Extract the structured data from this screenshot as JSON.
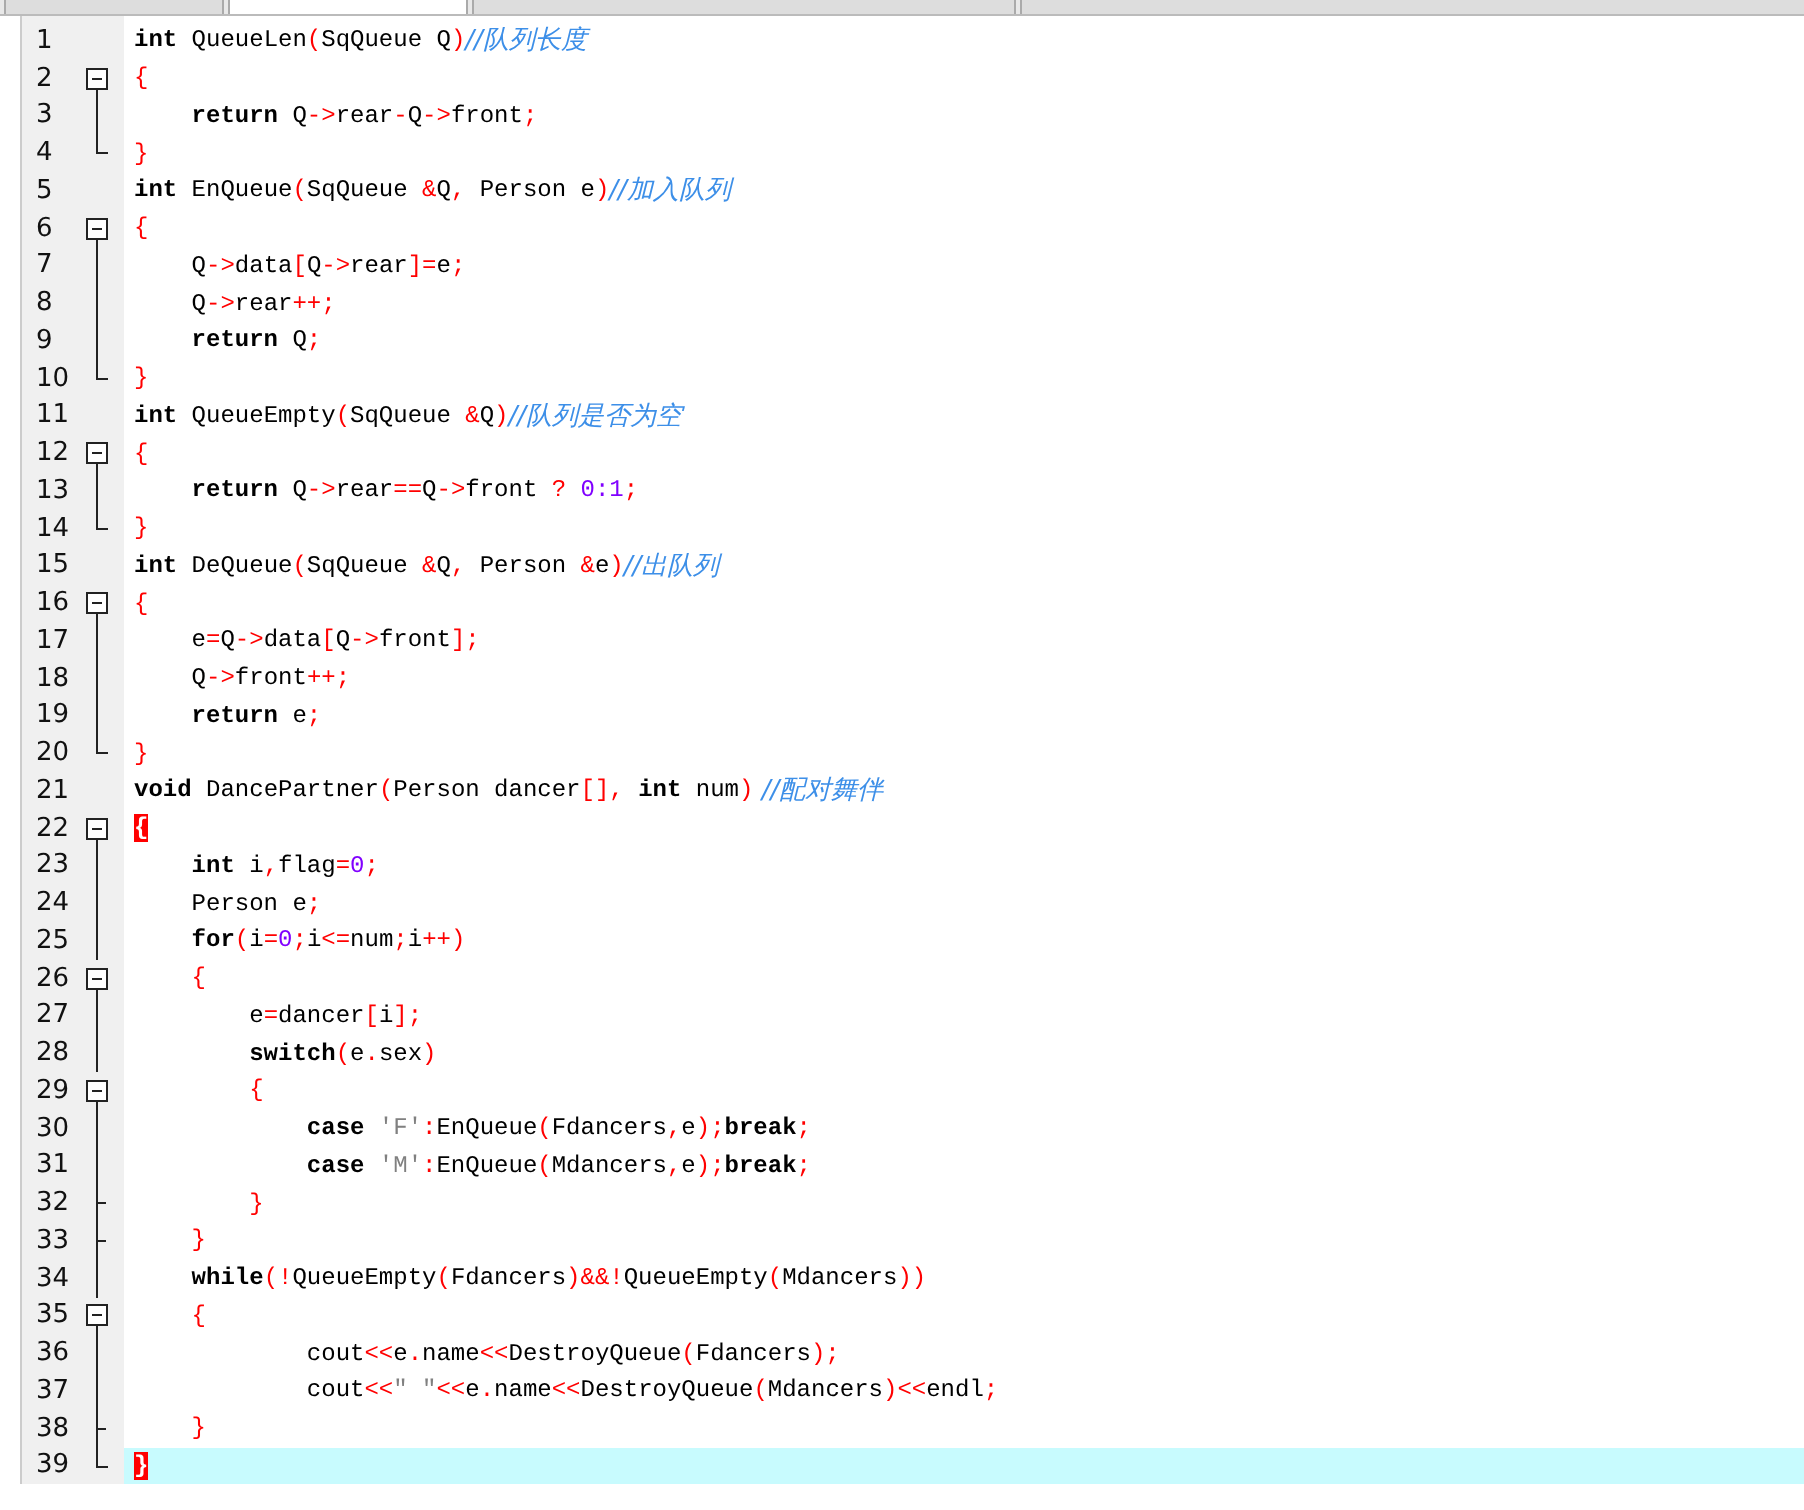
{
  "tabs": [
    {
      "selected": false
    },
    {
      "selected": true
    },
    {
      "selected": false
    },
    {
      "selected": false
    }
  ],
  "editor": {
    "lines": [
      {
        "number": "1",
        "kind": "fold-none",
        "current": false,
        "tokens": [
          {
            "kind": "kw",
            "text": "int"
          },
          {
            "kind": "id",
            "text": " QueueLen"
          },
          {
            "kind": "op",
            "text": "("
          },
          {
            "kind": "id",
            "text": "SqQueue Q"
          },
          {
            "kind": "op",
            "text": ")"
          },
          {
            "kind": "cmt",
            "text": "//队列长度"
          }
        ]
      },
      {
        "number": "2",
        "kind": "fold-open",
        "current": false,
        "tokens": [
          {
            "kind": "op",
            "text": "{"
          }
        ]
      },
      {
        "number": "3",
        "kind": "fold-body",
        "current": false,
        "tokens": [
          {
            "kind": "kw",
            "text": "    return"
          },
          {
            "kind": "id",
            "text": " Q"
          },
          {
            "kind": "op",
            "text": "->"
          },
          {
            "kind": "id",
            "text": "rear"
          },
          {
            "kind": "op",
            "text": "-"
          },
          {
            "kind": "id",
            "text": "Q"
          },
          {
            "kind": "op",
            "text": "->"
          },
          {
            "kind": "id",
            "text": "front"
          },
          {
            "kind": "op",
            "text": ";"
          }
        ]
      },
      {
        "number": "4",
        "kind": "fold-end",
        "current": false,
        "tokens": [
          {
            "kind": "op",
            "text": "}"
          }
        ]
      },
      {
        "number": "5",
        "kind": "fold-none",
        "current": false,
        "tokens": [
          {
            "kind": "kw",
            "text": "int"
          },
          {
            "kind": "id",
            "text": " EnQueue"
          },
          {
            "kind": "op",
            "text": "("
          },
          {
            "kind": "id",
            "text": "SqQueue "
          },
          {
            "kind": "op",
            "text": "&"
          },
          {
            "kind": "id",
            "text": "Q"
          },
          {
            "kind": "op",
            "text": ","
          },
          {
            "kind": "id",
            "text": " Person e"
          },
          {
            "kind": "op",
            "text": ")"
          },
          {
            "kind": "cmt",
            "text": "//加入队列"
          }
        ]
      },
      {
        "number": "6",
        "kind": "fold-open",
        "current": false,
        "tokens": [
          {
            "kind": "op",
            "text": "{"
          }
        ]
      },
      {
        "number": "7",
        "kind": "fold-body",
        "current": false,
        "tokens": [
          {
            "kind": "id",
            "text": "    Q"
          },
          {
            "kind": "op",
            "text": "->"
          },
          {
            "kind": "id",
            "text": "data"
          },
          {
            "kind": "op",
            "text": "["
          },
          {
            "kind": "id",
            "text": "Q"
          },
          {
            "kind": "op",
            "text": "->"
          },
          {
            "kind": "id",
            "text": "rear"
          },
          {
            "kind": "op",
            "text": "]="
          },
          {
            "kind": "id",
            "text": "e"
          },
          {
            "kind": "op",
            "text": ";"
          }
        ]
      },
      {
        "number": "8",
        "kind": "fold-body",
        "current": false,
        "tokens": [
          {
            "kind": "id",
            "text": "    Q"
          },
          {
            "kind": "op",
            "text": "->"
          },
          {
            "kind": "id",
            "text": "rear"
          },
          {
            "kind": "op",
            "text": "++;"
          }
        ]
      },
      {
        "number": "9",
        "kind": "fold-body",
        "current": false,
        "tokens": [
          {
            "kind": "kw",
            "text": "    return"
          },
          {
            "kind": "id",
            "text": " Q"
          },
          {
            "kind": "op",
            "text": ";"
          }
        ]
      },
      {
        "number": "10",
        "kind": "fold-end",
        "current": false,
        "tokens": [
          {
            "kind": "op",
            "text": "}"
          }
        ]
      },
      {
        "number": "11",
        "kind": "fold-none",
        "current": false,
        "tokens": [
          {
            "kind": "kw",
            "text": "int"
          },
          {
            "kind": "id",
            "text": " QueueEmpty"
          },
          {
            "kind": "op",
            "text": "("
          },
          {
            "kind": "id",
            "text": "SqQueue "
          },
          {
            "kind": "op",
            "text": "&"
          },
          {
            "kind": "id",
            "text": "Q"
          },
          {
            "kind": "op",
            "text": ")"
          },
          {
            "kind": "cmt",
            "text": "//队列是否为空"
          }
        ]
      },
      {
        "number": "12",
        "kind": "fold-open",
        "current": false,
        "tokens": [
          {
            "kind": "op",
            "text": "{"
          }
        ]
      },
      {
        "number": "13",
        "kind": "fold-body",
        "current": false,
        "tokens": [
          {
            "kind": "kw",
            "text": "    return"
          },
          {
            "kind": "id",
            "text": " Q"
          },
          {
            "kind": "op",
            "text": "->"
          },
          {
            "kind": "id",
            "text": "rear"
          },
          {
            "kind": "op",
            "text": "=="
          },
          {
            "kind": "id",
            "text": "Q"
          },
          {
            "kind": "op",
            "text": "->"
          },
          {
            "kind": "id",
            "text": "front "
          },
          {
            "kind": "op",
            "text": "? "
          },
          {
            "kind": "num",
            "text": "0:1"
          },
          {
            "kind": "op",
            "text": ";"
          }
        ]
      },
      {
        "number": "14",
        "kind": "fold-end",
        "current": false,
        "tokens": [
          {
            "kind": "op",
            "text": "}"
          }
        ]
      },
      {
        "number": "15",
        "kind": "fold-none",
        "current": false,
        "tokens": [
          {
            "kind": "kw",
            "text": "int"
          },
          {
            "kind": "id",
            "text": " DeQueue"
          },
          {
            "kind": "op",
            "text": "("
          },
          {
            "kind": "id",
            "text": "SqQueue "
          },
          {
            "kind": "op",
            "text": "&"
          },
          {
            "kind": "id",
            "text": "Q"
          },
          {
            "kind": "op",
            "text": ","
          },
          {
            "kind": "id",
            "text": " Person "
          },
          {
            "kind": "op",
            "text": "&"
          },
          {
            "kind": "id",
            "text": "e"
          },
          {
            "kind": "op",
            "text": ")"
          },
          {
            "kind": "cmt",
            "text": "//出队列"
          }
        ]
      },
      {
        "number": "16",
        "kind": "fold-open",
        "current": false,
        "tokens": [
          {
            "kind": "op",
            "text": "{"
          }
        ]
      },
      {
        "number": "17",
        "kind": "fold-body",
        "current": false,
        "tokens": [
          {
            "kind": "id",
            "text": "    e"
          },
          {
            "kind": "op",
            "text": "="
          },
          {
            "kind": "id",
            "text": "Q"
          },
          {
            "kind": "op",
            "text": "->"
          },
          {
            "kind": "id",
            "text": "data"
          },
          {
            "kind": "op",
            "text": "["
          },
          {
            "kind": "id",
            "text": "Q"
          },
          {
            "kind": "op",
            "text": "->"
          },
          {
            "kind": "id",
            "text": "front"
          },
          {
            "kind": "op",
            "text": "];"
          }
        ]
      },
      {
        "number": "18",
        "kind": "fold-body",
        "current": false,
        "tokens": [
          {
            "kind": "id",
            "text": "    Q"
          },
          {
            "kind": "op",
            "text": "->"
          },
          {
            "kind": "id",
            "text": "front"
          },
          {
            "kind": "op",
            "text": "++;"
          }
        ]
      },
      {
        "number": "19",
        "kind": "fold-body",
        "current": false,
        "tokens": [
          {
            "kind": "kw",
            "text": "    return"
          },
          {
            "kind": "id",
            "text": " e"
          },
          {
            "kind": "op",
            "text": ";"
          }
        ]
      },
      {
        "number": "20",
        "kind": "fold-end",
        "current": false,
        "tokens": [
          {
            "kind": "op",
            "text": "}"
          }
        ]
      },
      {
        "number": "21",
        "kind": "fold-none",
        "current": false,
        "tokens": [
          {
            "kind": "kw",
            "text": "void"
          },
          {
            "kind": "id",
            "text": " DancePartner"
          },
          {
            "kind": "op",
            "text": "("
          },
          {
            "kind": "id",
            "text": "Person dancer"
          },
          {
            "kind": "op",
            "text": "[],"
          },
          {
            "kind": "kw",
            "text": " int"
          },
          {
            "kind": "id",
            "text": " num"
          },
          {
            "kind": "op",
            "text": ")"
          },
          {
            "kind": "cmt",
            "text": " //配对舞伴"
          }
        ]
      },
      {
        "number": "22",
        "kind": "fold-open",
        "current": false,
        "tokens": [
          {
            "kind": "match",
            "text": "{"
          }
        ]
      },
      {
        "number": "23",
        "kind": "fold-body",
        "current": false,
        "tokens": [
          {
            "kind": "kw",
            "text": "    int"
          },
          {
            "kind": "id",
            "text": " i"
          },
          {
            "kind": "op",
            "text": ","
          },
          {
            "kind": "id",
            "text": "flag"
          },
          {
            "kind": "op",
            "text": "="
          },
          {
            "kind": "num",
            "text": "0"
          },
          {
            "kind": "op",
            "text": ";"
          }
        ]
      },
      {
        "number": "24",
        "kind": "fold-body",
        "current": false,
        "tokens": [
          {
            "kind": "id",
            "text": "    Person e"
          },
          {
            "kind": "op",
            "text": ";"
          }
        ]
      },
      {
        "number": "25",
        "kind": "fold-body",
        "current": false,
        "tokens": [
          {
            "kind": "kw",
            "text": "    for"
          },
          {
            "kind": "op",
            "text": "("
          },
          {
            "kind": "id",
            "text": "i"
          },
          {
            "kind": "op",
            "text": "="
          },
          {
            "kind": "num",
            "text": "0"
          },
          {
            "kind": "op",
            "text": ";"
          },
          {
            "kind": "id",
            "text": "i"
          },
          {
            "kind": "op",
            "text": "<="
          },
          {
            "kind": "id",
            "text": "num"
          },
          {
            "kind": "op",
            "text": ";"
          },
          {
            "kind": "id",
            "text": "i"
          },
          {
            "kind": "op",
            "text": "++)"
          }
        ]
      },
      {
        "number": "26",
        "kind": "fold-open",
        "current": false,
        "tokens": [
          {
            "kind": "op",
            "text": "    {"
          }
        ]
      },
      {
        "number": "27",
        "kind": "fold-body",
        "current": false,
        "tokens": [
          {
            "kind": "id",
            "text": "        e"
          },
          {
            "kind": "op",
            "text": "="
          },
          {
            "kind": "id",
            "text": "dancer"
          },
          {
            "kind": "op",
            "text": "["
          },
          {
            "kind": "id",
            "text": "i"
          },
          {
            "kind": "op",
            "text": "];"
          }
        ]
      },
      {
        "number": "28",
        "kind": "fold-body",
        "current": false,
        "tokens": [
          {
            "kind": "kw",
            "text": "        switch"
          },
          {
            "kind": "op",
            "text": "("
          },
          {
            "kind": "id",
            "text": "e"
          },
          {
            "kind": "op",
            "text": "."
          },
          {
            "kind": "id",
            "text": "sex"
          },
          {
            "kind": "op",
            "text": ")"
          }
        ]
      },
      {
        "number": "29",
        "kind": "fold-open",
        "current": false,
        "tokens": [
          {
            "kind": "op",
            "text": "        {"
          }
        ]
      },
      {
        "number": "30",
        "kind": "fold-body",
        "current": false,
        "tokens": [
          {
            "kind": "kw",
            "text": "            case "
          },
          {
            "kind": "str",
            "text": "'F'"
          },
          {
            "kind": "op",
            "text": ":"
          },
          {
            "kind": "id",
            "text": "EnQueue"
          },
          {
            "kind": "op",
            "text": "("
          },
          {
            "kind": "id",
            "text": "Fdancers"
          },
          {
            "kind": "op",
            "text": ","
          },
          {
            "kind": "id",
            "text": "e"
          },
          {
            "kind": "op",
            "text": ");"
          },
          {
            "kind": "kw",
            "text": "break"
          },
          {
            "kind": "op",
            "text": ";"
          }
        ]
      },
      {
        "number": "31",
        "kind": "fold-body",
        "current": false,
        "tokens": [
          {
            "kind": "kw",
            "text": "            case "
          },
          {
            "kind": "str",
            "text": "'M'"
          },
          {
            "kind": "op",
            "text": ":"
          },
          {
            "kind": "id",
            "text": "EnQueue"
          },
          {
            "kind": "op",
            "text": "("
          },
          {
            "kind": "id",
            "text": "Mdancers"
          },
          {
            "kind": "op",
            "text": ","
          },
          {
            "kind": "id",
            "text": "e"
          },
          {
            "kind": "op",
            "text": ");"
          },
          {
            "kind": "kw",
            "text": "break"
          },
          {
            "kind": "op",
            "text": ";"
          }
        ]
      },
      {
        "number": "32",
        "kind": "fold-inner-end",
        "current": false,
        "tokens": [
          {
            "kind": "op",
            "text": "        }"
          }
        ]
      },
      {
        "number": "33",
        "kind": "fold-inner-end",
        "current": false,
        "tokens": [
          {
            "kind": "op",
            "text": "    }"
          }
        ]
      },
      {
        "number": "34",
        "kind": "fold-body",
        "current": false,
        "tokens": [
          {
            "kind": "kw",
            "text": "    while"
          },
          {
            "kind": "op",
            "text": "(!"
          },
          {
            "kind": "id",
            "text": "QueueEmpty"
          },
          {
            "kind": "op",
            "text": "("
          },
          {
            "kind": "id",
            "text": "Fdancers"
          },
          {
            "kind": "op",
            "text": ")&&!"
          },
          {
            "kind": "id",
            "text": "QueueEmpty"
          },
          {
            "kind": "op",
            "text": "("
          },
          {
            "kind": "id",
            "text": "Mdancers"
          },
          {
            "kind": "op",
            "text": "))"
          }
        ]
      },
      {
        "number": "35",
        "kind": "fold-open",
        "current": false,
        "tokens": [
          {
            "kind": "op",
            "text": "    {"
          }
        ]
      },
      {
        "number": "36",
        "kind": "fold-body",
        "current": false,
        "tokens": [
          {
            "kind": "id",
            "text": "            cout"
          },
          {
            "kind": "op",
            "text": "<<"
          },
          {
            "kind": "id",
            "text": "e"
          },
          {
            "kind": "op",
            "text": "."
          },
          {
            "kind": "id",
            "text": "name"
          },
          {
            "kind": "op",
            "text": "<<"
          },
          {
            "kind": "id",
            "text": "DestroyQueue"
          },
          {
            "kind": "op",
            "text": "("
          },
          {
            "kind": "id",
            "text": "Fdancers"
          },
          {
            "kind": "op",
            "text": ");"
          }
        ]
      },
      {
        "number": "37",
        "kind": "fold-body",
        "current": false,
        "tokens": [
          {
            "kind": "id",
            "text": "            cout"
          },
          {
            "kind": "op",
            "text": "<<"
          },
          {
            "kind": "str",
            "text": "\" \""
          },
          {
            "kind": "op",
            "text": "<<"
          },
          {
            "kind": "id",
            "text": "e"
          },
          {
            "kind": "op",
            "text": "."
          },
          {
            "kind": "id",
            "text": "name"
          },
          {
            "kind": "op",
            "text": "<<"
          },
          {
            "kind": "id",
            "text": "DestroyQueue"
          },
          {
            "kind": "op",
            "text": "("
          },
          {
            "kind": "id",
            "text": "Mdancers"
          },
          {
            "kind": "op",
            "text": ")<<"
          },
          {
            "kind": "id",
            "text": "endl"
          },
          {
            "kind": "op",
            "text": ";"
          }
        ]
      },
      {
        "number": "38",
        "kind": "fold-inner-end",
        "current": false,
        "tokens": [
          {
            "kind": "op",
            "text": "    }"
          }
        ]
      },
      {
        "number": "39",
        "kind": "fold-end",
        "current": true,
        "tokens": [
          {
            "kind": "match",
            "text": "}"
          }
        ]
      }
    ]
  }
}
